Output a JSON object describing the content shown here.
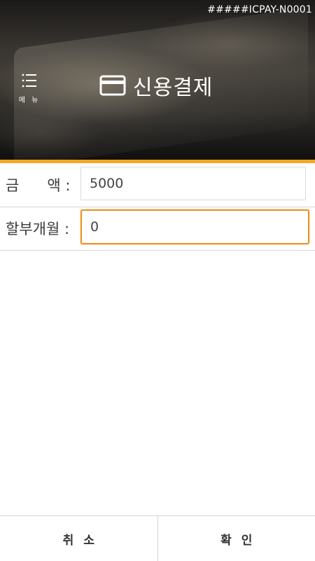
{
  "status": {
    "device_id": "#####ICPAY-N0001"
  },
  "header": {
    "menu_label": "메 뉴",
    "menu_icon": "hamburger-list-icon",
    "title": "신용결제",
    "title_icon": "credit-card-icon"
  },
  "form": {
    "amount": {
      "label": "금      액 :",
      "value": "5000"
    },
    "installment": {
      "label": "할부개월 :",
      "value": "0"
    }
  },
  "buttons": {
    "cancel_label": "취소",
    "confirm_label": "확인"
  },
  "colors": {
    "accent": "#f5a623",
    "focus_border": "#e8921e"
  }
}
